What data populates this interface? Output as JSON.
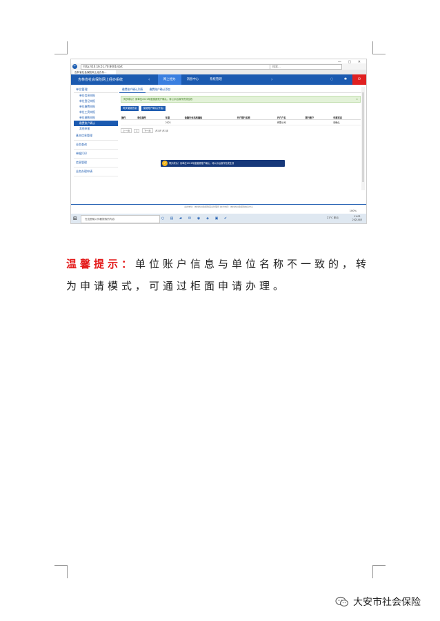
{
  "screenshot": {
    "browser": {
      "url": "http://10.16.51.70:8001/sb/t",
      "search_placeholder": "搜索...",
      "tab_title": "吉林省社会保险网上经办系..."
    },
    "app": {
      "title": "吉林省社会保险网上经办系统",
      "menu": [
        "网上经办",
        "消息中心",
        "系统管理"
      ],
      "icons": [
        "chat-icon",
        "settings-icon",
        "power-icon"
      ]
    },
    "sidebar": {
      "head": "单位管理",
      "items": [
        "单位信息申报",
        "单位登记申报",
        "单位缴费申报",
        "单位工资申报",
        "单位基数申报",
        "缴费账户确认",
        "其他申报"
      ],
      "groups": [
        "基本信息管理",
        "业务查询",
        "单据打印",
        "信息管理",
        "业务办理申请"
      ]
    },
    "content": {
      "tabs": [
        "缴费账户确认列表",
        "缴费账户确认添加"
      ],
      "notice": "同步成功！请单位2021年度缴费账户确认，待公示后操作完成生效",
      "buttons": [
        "同步缴费信息",
        "缴费账户确认(开始)"
      ],
      "table": {
        "headers": [
          "操作",
          "单位编号",
          "年度",
          "金融行业机构编码",
          "开户银行名称",
          "开户户名",
          "银行账户",
          "申报状态"
        ],
        "rows": [
          [
            "",
            "",
            "2021",
            "",
            "",
            "有限公司",
            "",
            "待确认"
          ]
        ]
      },
      "pager": [
        "上一页",
        "1",
        "下一页",
        "共1页",
        "共1条"
      ],
      "toast": "同步成功！请单位2021年度缴费账户确认，待公示后操作完成生效"
    },
    "footer": "主办单位：吉林省社会保险事业管理局 技术支持：吉林省社会保险信息中心",
    "zoom": "100%",
    "taskbar": {
      "search_placeholder": "在这里输入你要搜索的内容",
      "weather": "21°C 多云",
      "time": "11:03",
      "date": "2021/8/3"
    }
  },
  "tip": {
    "label": "温馨提示：",
    "text": "单位账户信息与单位名称不一致的，转为申请模式，可通过柜面申请办理。"
  },
  "brand": {
    "name": "大安市社会保险"
  }
}
